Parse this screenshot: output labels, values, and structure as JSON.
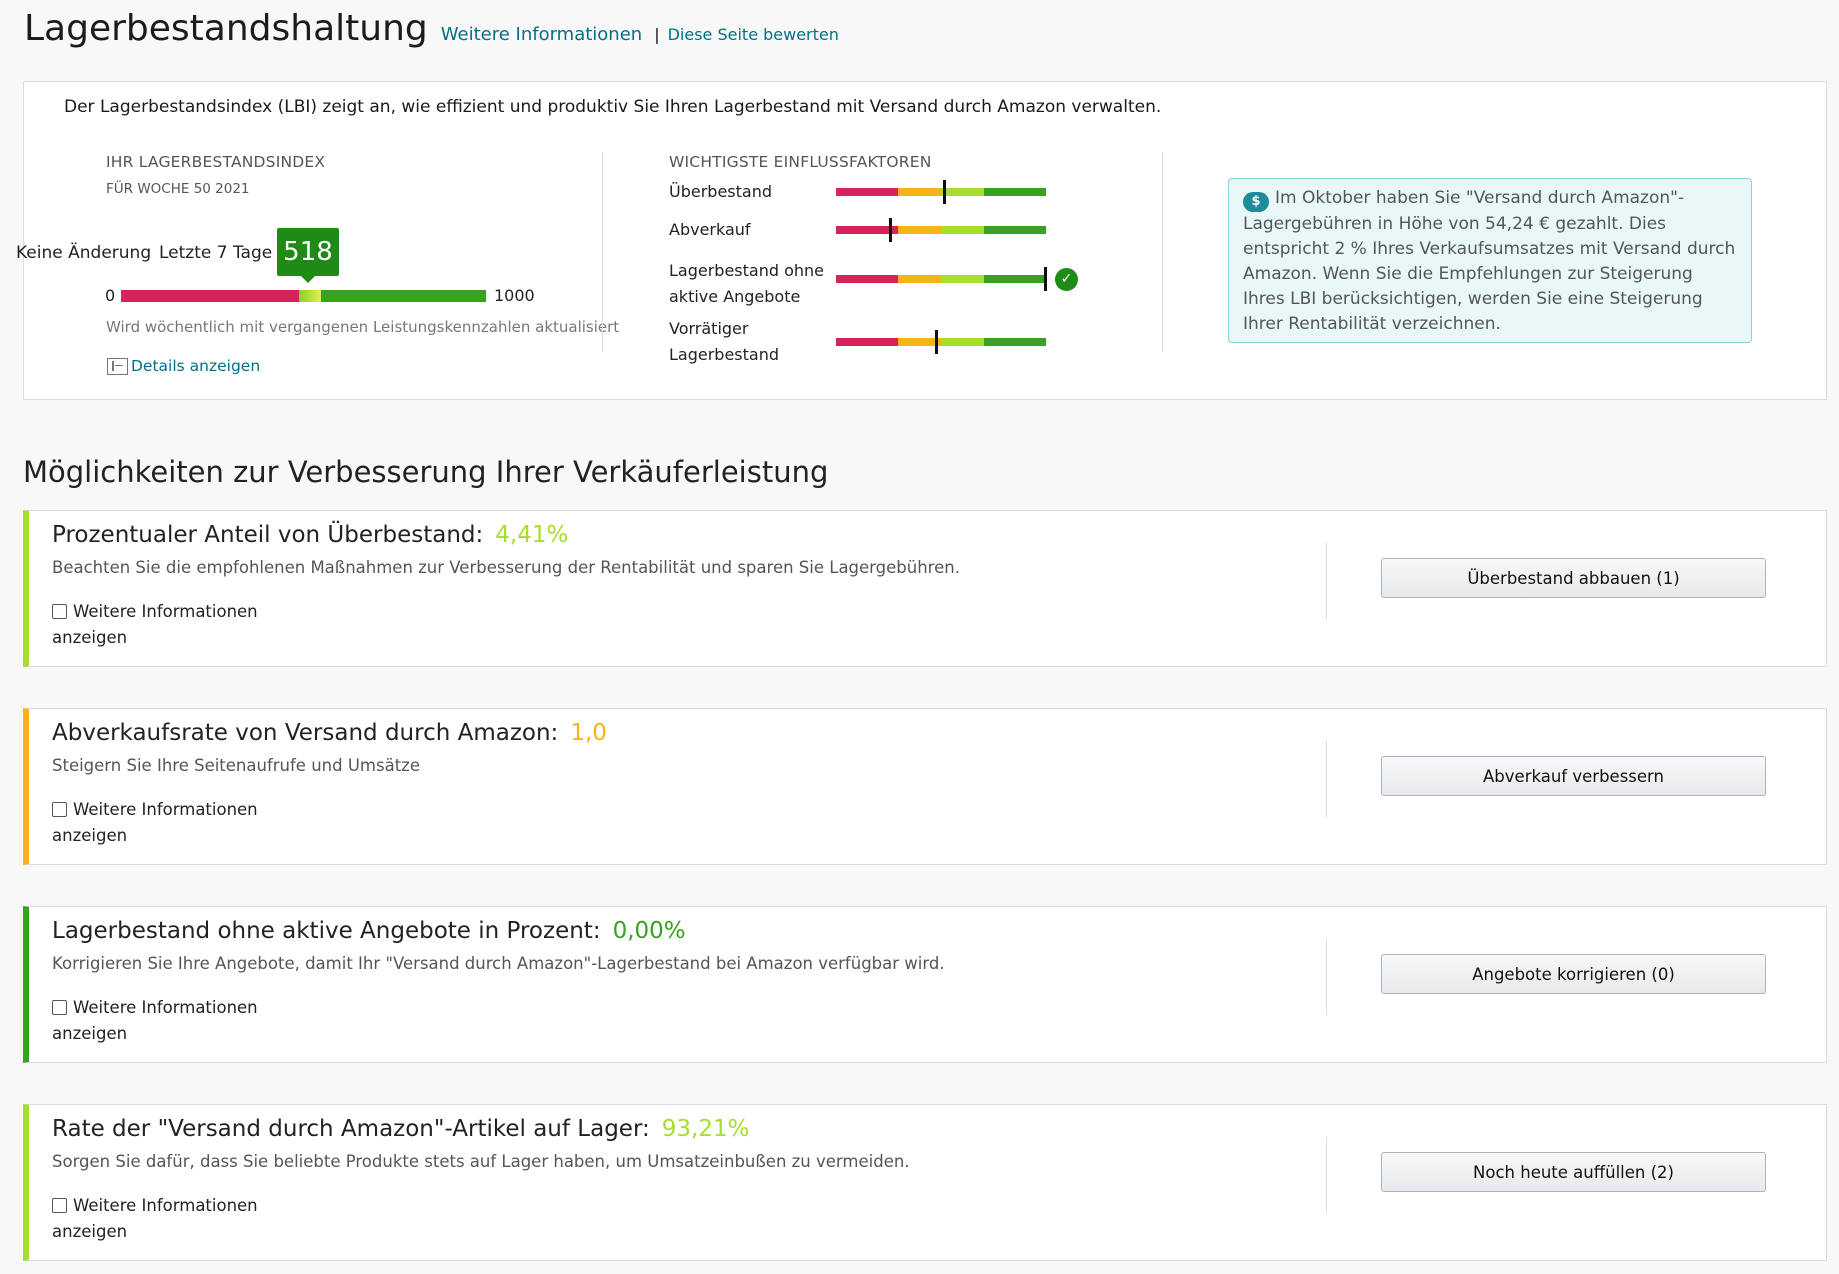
{
  "header": {
    "title": "Lagerbestandshaltung",
    "more_info_link": "Weitere Informationen",
    "separator": "|",
    "rate_link": "Diese Seite bewerten"
  },
  "lbi": {
    "intro": "Der Lagerbestandsindex (LBI) zeigt an, wie effizient und produktiv Sie Ihren Lagerbestand mit Versand durch Amazon verwalten.",
    "caption": "IHR LAGERBESTANDSINDEX",
    "week": "FÜR WOCHE 50 2021",
    "change": "Keine Änderung",
    "period": "Letzte 7 Tage",
    "score": "518",
    "min": "0",
    "max": "1000",
    "score_fraction": 0.518,
    "update_note": "Wird wöchentlich mit vergangenen Leistungskennzahlen aktualisiert",
    "details_link": "Details anzeigen",
    "details_icon": "panel-icon"
  },
  "factors": {
    "caption": "WICHTIGSTE EINFLUSSFAKTOREN",
    "items": [
      {
        "label_line1": "Überbestand",
        "label_line2": "",
        "level": 0.52
      },
      {
        "label_line1": "Abverkauf",
        "label_line2": "",
        "level": 0.26
      },
      {
        "label_line1": "Lagerbestand ohne",
        "label_line2": "aktive Angebote",
        "level": 1.0,
        "check_icon": "checkmark-icon"
      },
      {
        "label_line1": "Vorrätiger",
        "label_line2": "Lagerbestand",
        "level": 0.48
      }
    ],
    "colors": [
      "#d5245a",
      "#f6b418",
      "#a6dd2e",
      "#37a21f"
    ]
  },
  "info": {
    "icon": "dollar-icon",
    "text": "Im Oktober haben Sie \"Versand durch Amazon\"-Lagergebühren in Höhe von 54,24 € gezahlt. Dies entspricht 2 % Ihres Verkaufsumsatzes mit Versand durch Amazon. Wenn Sie die Empfehlungen zur Steigerung Ihres LBI berücksichtigen, werden Sie eine Steigerung Ihrer Rentabilität verzeichnen."
  },
  "improvements": {
    "title": "Möglichkeiten zur Verbesserung Ihrer Verkäuferleistung",
    "more_line1": "Weitere Informationen",
    "more_line2": "anzeigen",
    "cards": [
      {
        "title": "Prozentualer Anteil von Überbestand:",
        "value": "4,41%",
        "color": "#a6dd2e",
        "desc": "Beachten Sie die empfohlenen Maßnahmen zur Verbesserung der Rentabilität und sparen Sie Lagergebühren.",
        "button": "Überbestand abbauen (1)"
      },
      {
        "title": "Abverkaufsrate von Versand durch Amazon:",
        "value": "1,0",
        "color": "#f6b418",
        "desc": "Steigern Sie Ihre Seitenaufrufe und Umsätze",
        "button": "Abverkauf verbessern"
      },
      {
        "title": "Lagerbestand ohne aktive Angebote in Prozent:",
        "value": "0,00%",
        "color": "#37a21f",
        "desc": "Korrigieren Sie Ihre Angebote, damit Ihr \"Versand durch Amazon\"-Lagerbestand bei Amazon verfügbar wird.",
        "button": "Angebote korrigieren (0)"
      },
      {
        "title": "Rate der \"Versand durch Amazon\"-Artikel auf Lager:",
        "value": "93,21%",
        "color": "#a6dd2e",
        "desc": "Sorgen Sie dafür, dass Sie beliebte Produkte stets auf Lager haben, um Umsatzeinbußen zu vermeiden.",
        "button": "Noch heute auffüllen (2)"
      }
    ]
  }
}
